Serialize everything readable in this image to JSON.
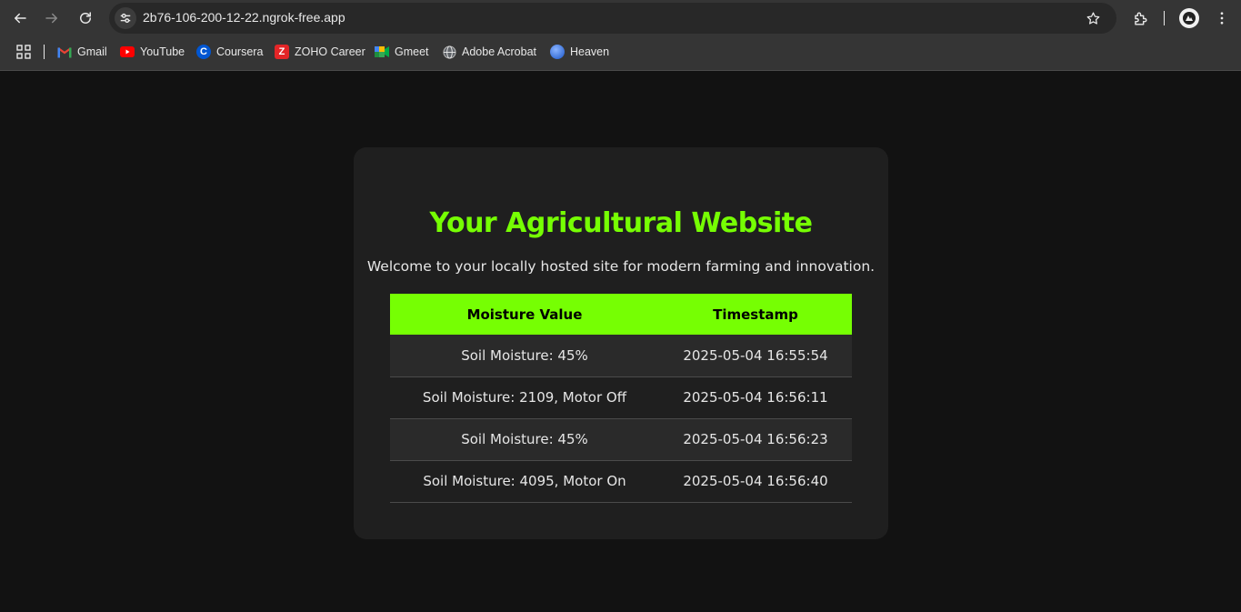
{
  "browser": {
    "url": "2b76-106-200-12-22.ngrok-free.app",
    "bookmarks": [
      {
        "label": "Gmail",
        "icon": "gmail-icon"
      },
      {
        "label": "YouTube",
        "icon": "youtube-icon"
      },
      {
        "label": "Coursera",
        "icon": "coursera-icon"
      },
      {
        "label": "ZOHO Career",
        "icon": "zoho-icon"
      },
      {
        "label": "Gmeet",
        "icon": "gmeet-icon"
      },
      {
        "label": "Adobe Acrobat",
        "icon": "globe-icon"
      },
      {
        "label": "Heaven",
        "icon": "heaven-icon"
      }
    ]
  },
  "page": {
    "title": "Your Agricultural Website",
    "intro": "Welcome to your locally hosted site for modern farming and innovation.",
    "accent_color": "#76ff03",
    "table": {
      "headers": [
        "Moisture Value",
        "Timestamp"
      ],
      "rows": [
        [
          "Soil Moisture: 45%",
          "2025-05-04 16:55:54"
        ],
        [
          "Soil Moisture: 2109, Motor Off",
          "2025-05-04 16:56:11"
        ],
        [
          "Soil Moisture: 45%",
          "2025-05-04 16:56:23"
        ],
        [
          "Soil Moisture: 4095, Motor On",
          "2025-05-04 16:56:40"
        ]
      ]
    }
  }
}
